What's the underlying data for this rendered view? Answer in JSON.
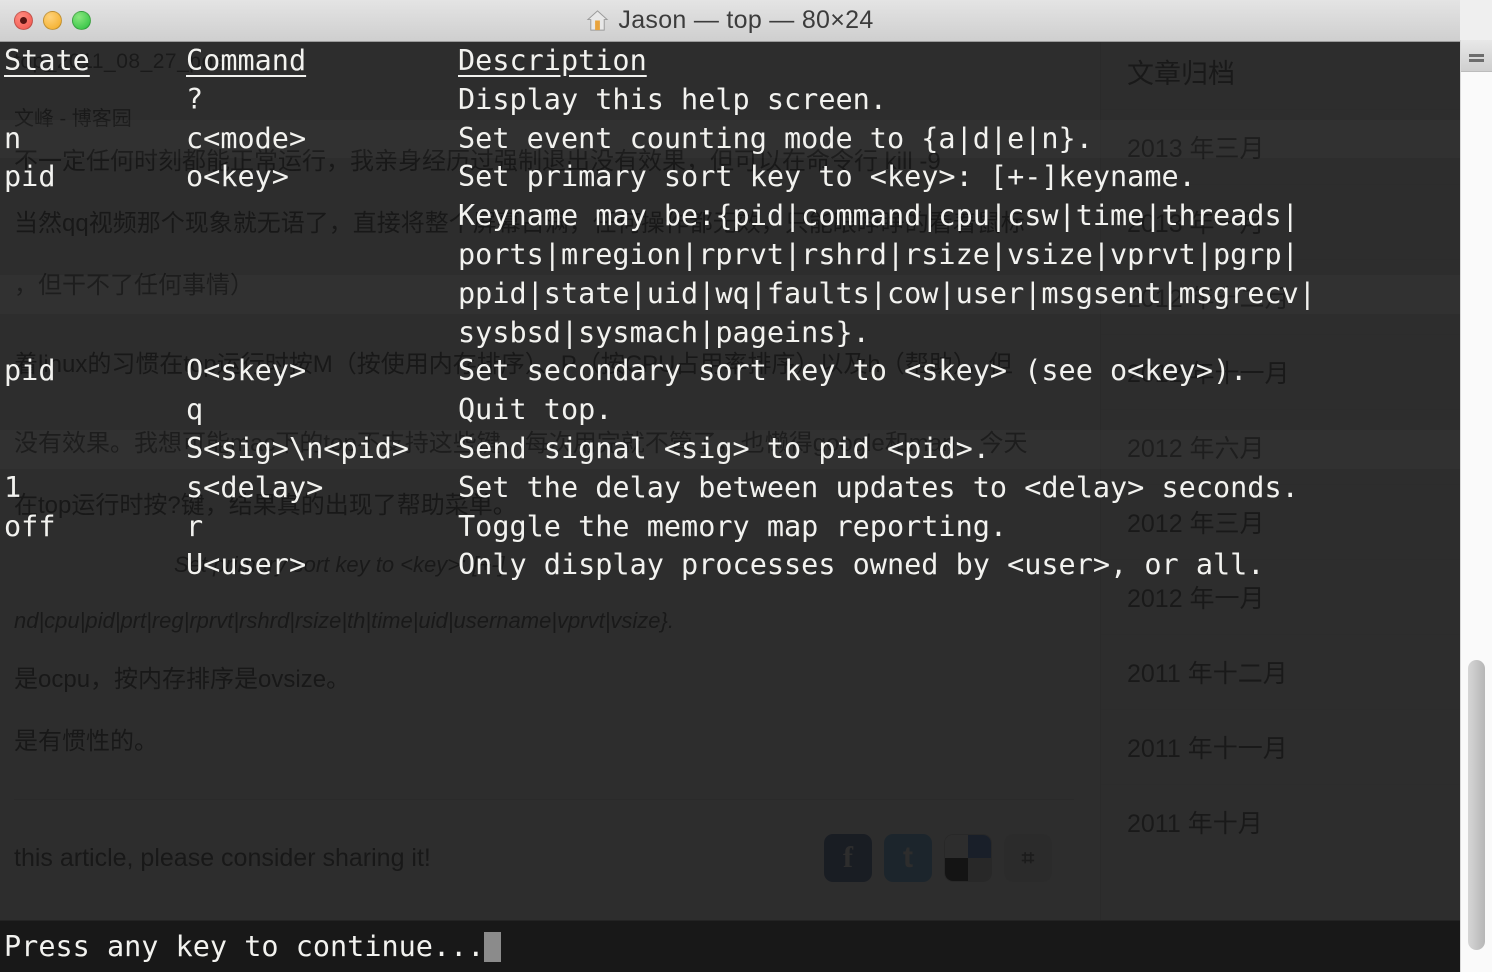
{
  "window": {
    "title": "Jason — top — 80×24",
    "home_icon": "home-icon",
    "controls": {
      "close": "close",
      "minimize": "minimize",
      "zoom": "zoom"
    }
  },
  "terminal": {
    "headers": {
      "state": "State",
      "command": "Command",
      "description": "Description"
    },
    "rows": [
      {
        "state": "",
        "command": "?",
        "description": "Display this help screen."
      },
      {
        "state": "n",
        "command": "c<mode>",
        "description": "Set event counting mode to {a|d|e|n}."
      },
      {
        "state": "pid",
        "command": "o<key>",
        "description": "Set primary sort key to <key>: [+-]keyname."
      },
      {
        "state": "",
        "command": "",
        "description": "Keyname may be:{pid|command|cpu|csw|time|threads|"
      },
      {
        "state": "",
        "command": "",
        "description": "ports|mregion|rprvt|rshrd|rsize|vsize|vprvt|pgrp|"
      },
      {
        "state": "",
        "command": "",
        "description": "ppid|state|uid|wq|faults|cow|user|msgsent|msgrecv|"
      },
      {
        "state": "",
        "command": "",
        "description": "sysbsd|sysmach|pageins}."
      },
      {
        "state": "pid",
        "command": "O<skey>",
        "description": "Set secondary sort key to <skey> (see o<key>)."
      },
      {
        "state": "",
        "command": "q",
        "description": "Quit top."
      },
      {
        "state": "",
        "command": "S<sig>\\n<pid>",
        "description": "Send signal <sig> to pid <pid>."
      },
      {
        "state": "1",
        "command": "s<delay>",
        "description": "Set the delay between updates to <delay> seconds."
      },
      {
        "state": "off",
        "command": "r",
        "description": "Toggle the memory map reporting."
      },
      {
        "state": "",
        "command": "U<user>",
        "description": "Only display processes owned by <user>, or all."
      }
    ],
    "prompt": "Press any key to continue..."
  },
  "background_page": {
    "breadcrumb": "top_2011_08_27_post",
    "byline": "文峰 - 博客园",
    "paragraphs": [
      "不一定任何时刻都能正常运行，我亲身经历过强制退出没有效果，但可以在命令行 kill -9",
      "当然qq视频那个现象就无语了，直接将整个屏幕占满，任何操作都无效，只能眼睁睁的看着鼠标",
      "，但干不了任何事情）",
      "着linux的习惯在top运行时按M（按使用内存排序）、P（按CPU占用率排序）以及h（帮助），但",
      "没有效果。我想可能mac下的top不支持这些键，每次用完就不管了，也懒得google和man，今天",
      "在top运行时按?键，结果真的出现了帮助菜单。",
      "是ocpu，按内存排序是ovsize。",
      "是有惯性的。"
    ],
    "code_lines": [
      "Set primary sort key to <key>: [+-]",
      "nd|cpu|pid|prt|reg|rprvt|rshrd|rsize|th|time|uid|username|vprvt|vsize}."
    ],
    "share_text": "this article, please consider sharing it!",
    "share_icons": [
      {
        "name": "facebook-icon",
        "glyph": "f"
      },
      {
        "name": "twitter-icon",
        "glyph": "t"
      },
      {
        "name": "delicious-icon",
        "glyph": ""
      },
      {
        "name": "other-share-icon",
        "glyph": "⌗"
      }
    ],
    "sidebar": {
      "title": "文章归档",
      "items": [
        "2013 年三月",
        "2013 年一月",
        "2012 年十二月",
        "2012 年十一月",
        "2012 年六月",
        "2012 年三月",
        "2012 年一月",
        "2011 年十二月",
        "2011 年十一月",
        "2011 年十月"
      ]
    }
  },
  "colors": {
    "terminal_bg": "#161616",
    "terminal_fg": "#f2f2ef",
    "titlebar": "#d8d8d8",
    "close": "#f2544b",
    "minimize": "#f3ab22",
    "zoom": "#27bf3c"
  }
}
